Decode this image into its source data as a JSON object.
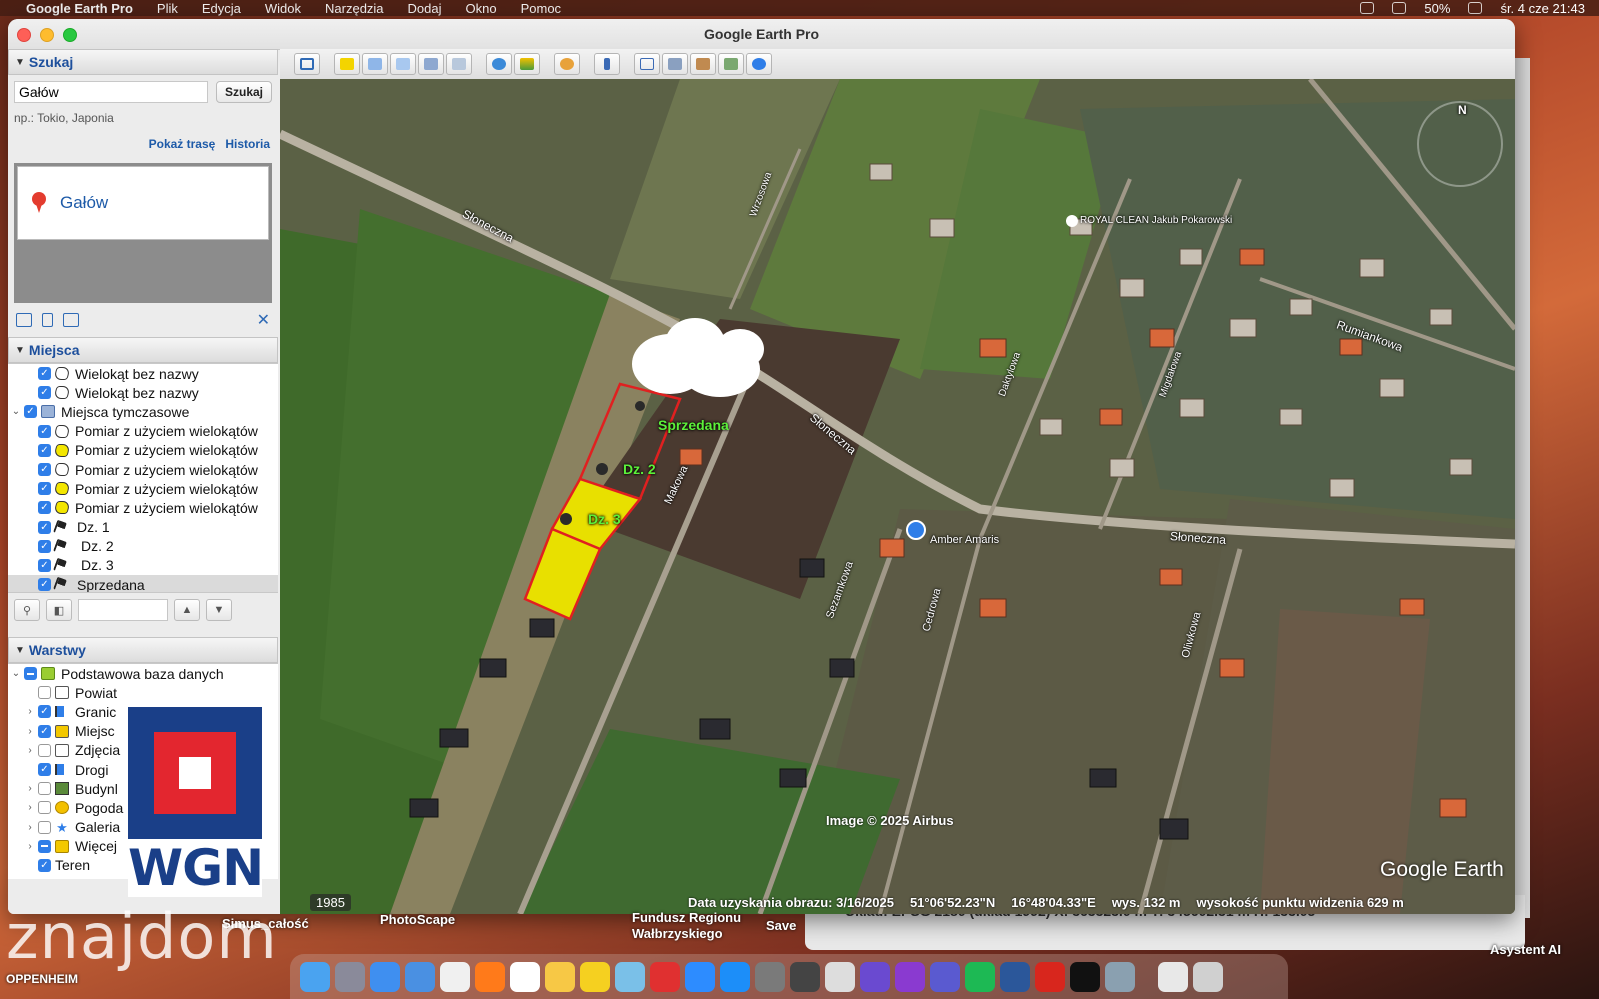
{
  "menubar": {
    "items": [
      "Google Earth Pro",
      "Plik",
      "Edycja",
      "Widok",
      "Narzędzia",
      "Dodaj",
      "Okno",
      "Pomoc"
    ],
    "clock": "śr. 4 cze 21:43",
    "battery": "50%"
  },
  "window": {
    "title": "Google Earth Pro"
  },
  "search": {
    "header": "Szukaj",
    "value": "Gałów",
    "button": "Szukaj",
    "hint": "np.: Tokio, Japonia",
    "link_route": "Pokaż trasę",
    "link_history": "Historia",
    "result": "Gałów"
  },
  "places": {
    "header": "Miejsca",
    "items": [
      {
        "label": "Wielokąt bez nazwy",
        "icon": "polygon-white-icon",
        "checked": true,
        "level": 1
      },
      {
        "label": "Wielokąt bez nazwy",
        "icon": "polygon-white-icon",
        "checked": true,
        "level": 1
      },
      {
        "label": "Miejsca tymczasowe",
        "icon": "folder-icon",
        "checked": true,
        "level": 0
      },
      {
        "label": "Pomiar z użyciem wielokątów",
        "icon": "polygon-white-icon",
        "checked": true,
        "level": 1
      },
      {
        "label": "Pomiar z użyciem wielokątów",
        "icon": "polygon-yellow-icon",
        "checked": true,
        "level": 1
      },
      {
        "label": "Pomiar z użyciem wielokątów",
        "icon": "polygon-white-icon",
        "checked": true,
        "level": 1
      },
      {
        "label": "Pomiar z użyciem wielokątów",
        "icon": "polygon-yellow-icon",
        "checked": true,
        "level": 1
      },
      {
        "label": "Pomiar z użyciem wielokątów",
        "icon": "polygon-yellow-icon",
        "checked": true,
        "level": 1
      },
      {
        "label": "Dz. 1",
        "icon": "pushpin-icon",
        "checked": true,
        "level": 1
      },
      {
        "label": "Dz. 2",
        "icon": "pushpin-icon",
        "checked": true,
        "level": 1
      },
      {
        "label": "Dz. 3",
        "icon": "pushpin-icon",
        "checked": true,
        "level": 1
      },
      {
        "label": "Sprzedana",
        "icon": "pushpin-icon",
        "checked": true,
        "level": 1
      }
    ]
  },
  "layers": {
    "header": "Warstwy",
    "items": [
      {
        "label": "Podstawowa baza danych",
        "icon": "database-icon",
        "state": "mixed"
      },
      {
        "label": "Powiat",
        "icon": "envelope-icon",
        "state": "off"
      },
      {
        "label": "Granic",
        "icon": "border-flag-icon",
        "state": "on"
      },
      {
        "label": "Miejsc",
        "icon": "place-icon",
        "state": "on"
      },
      {
        "label": "Zdjęcia",
        "icon": "photo-icon",
        "state": "off"
      },
      {
        "label": "Drogi",
        "icon": "road-icon",
        "state": "on"
      },
      {
        "label": "Budynl",
        "icon": "building-icon",
        "state": "off"
      },
      {
        "label": "Pogoda",
        "icon": "weather-sun-icon",
        "state": "off"
      },
      {
        "label": "Galeria",
        "icon": "star-icon",
        "state": "off"
      },
      {
        "label": "Więcej",
        "icon": "folder-yellow-icon",
        "state": "mixed"
      },
      {
        "label": "Teren",
        "icon": "",
        "state": "on"
      }
    ]
  },
  "map": {
    "labels": {
      "dz2": "Dz. 2",
      "dz3": "Dz. 3",
      "sprzedana": "Sprzedana",
      "sloneczna1": "Słoneczna",
      "sloneczna2": "Słoneczna",
      "sloneczna3": "Słoneczna",
      "wrzosowa": "Wrzosowa",
      "makowa": "Makowa",
      "sezamkowa": "Sezamkowa",
      "cedrowa": "Cedrowa",
      "oliwkowa": "Oliwkowa",
      "daktylowa": "Daktylowa",
      "migdalowa": "Migdałowa",
      "rumiankowa": "Rumiankowa",
      "amber": "Amber Amaris",
      "royal": "ROYAL CLEAN Jakub Pokarowski"
    },
    "attribution": "Image © 2025 Airbus",
    "logo": "Google Earth",
    "year": "1985",
    "status": {
      "date": "Data uzyskania obrazu: 3/16/2025",
      "lat": "51°06'52.23\"N",
      "lon": "16°48'04.33\"E",
      "elev": "wys. 132 m",
      "eye": "wysokość punktu widzenia 629 m"
    },
    "compass": "N"
  },
  "overlay": {
    "brand": "WGN",
    "watermark": "znajdom"
  },
  "desktop": {
    "labels": [
      "Simus_całość",
      "PhotoScape",
      "Fundusz Regionu Wałbrzyskiego",
      "Save",
      "OPPENHEIM",
      "Asystent AI"
    ],
    "bg_status": "Układ: EPSG 2180 (układ 1992)   X: 363323.0 m   Y: 345602.31 m   H: 133.05"
  }
}
